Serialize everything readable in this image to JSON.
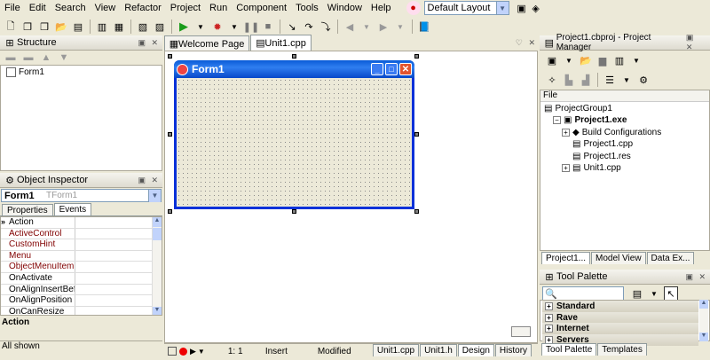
{
  "menu": [
    "File",
    "Edit",
    "Search",
    "View",
    "Refactor",
    "Project",
    "Run",
    "Component",
    "Tools",
    "Window",
    "Help"
  ],
  "layout_combo": {
    "value": "Default Layout"
  },
  "structure": {
    "title": "Structure",
    "items": [
      "Form1"
    ]
  },
  "object_inspector": {
    "title": "Object Inspector",
    "selected_name": "Form1",
    "selected_type": "TForm1",
    "tabs": [
      "Properties",
      "Events"
    ],
    "active_tab": "Events",
    "rows": [
      "Action",
      "ActiveControl",
      "CustomHint",
      "Menu",
      "ObjectMenuItem",
      "OnActivate",
      "OnAlignInsertBefore",
      "OnAlignPosition",
      "OnCanResize"
    ],
    "highlighted_rows": [
      "ActiveControl",
      "CustomHint",
      "Menu",
      "ObjectMenuItem"
    ],
    "description": "Action",
    "status": "All shown"
  },
  "editor": {
    "tabs": [
      "Welcome Page",
      "Unit1.cpp"
    ],
    "active_tab": "Unit1.cpp",
    "form_caption": "Form1"
  },
  "statusbar": {
    "position": "1: 1",
    "mode": "Insert",
    "state": "Modified",
    "bottom_tabs": [
      "Unit1.cpp",
      "Unit1.h",
      "Design",
      "History"
    ],
    "active_bottom_tab": "Design"
  },
  "project_manager": {
    "title": "Project1.cbproj - Project Manager",
    "column": "File",
    "tree": [
      {
        "label": "ProjectGroup1",
        "level": 0,
        "bold": false
      },
      {
        "label": "Project1.exe",
        "level": 1,
        "bold": true
      },
      {
        "label": "Build Configurations",
        "level": 2,
        "bold": false
      },
      {
        "label": "Project1.cpp",
        "level": 2,
        "bold": false
      },
      {
        "label": "Project1.res",
        "level": 2,
        "bold": false
      },
      {
        "label": "Unit1.cpp",
        "level": 2,
        "bold": false
      }
    ],
    "bottom_tabs": [
      "Project1...",
      "Model View",
      "Data Ex..."
    ]
  },
  "tool_palette": {
    "title": "Tool Palette",
    "categories": [
      "Standard",
      "Rave",
      "Internet",
      "Servers"
    ],
    "bottom_tabs": [
      "Tool Palette",
      "Templates"
    ]
  }
}
